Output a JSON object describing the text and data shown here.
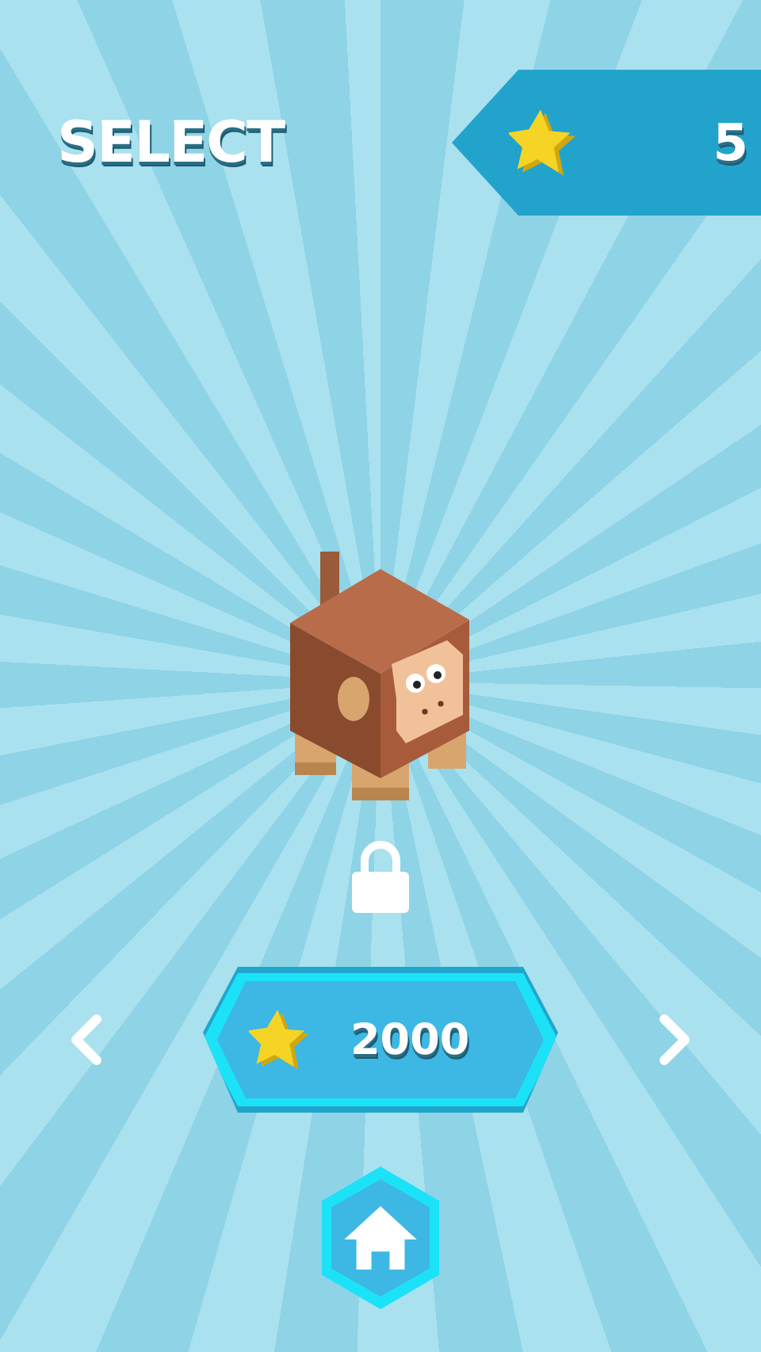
{
  "header": {
    "title": "SELECT",
    "stars": "5"
  },
  "character": {
    "locked": true
  },
  "price": {
    "amount": "2000"
  }
}
